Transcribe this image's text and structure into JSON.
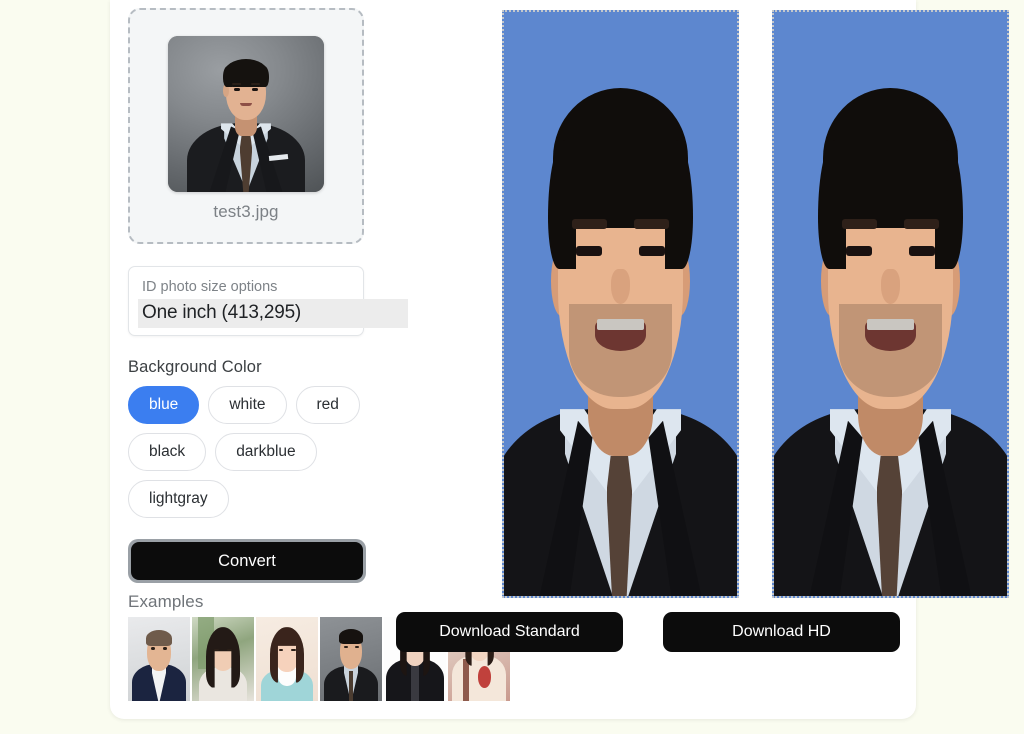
{
  "page": {
    "background_color": "#fafcf0",
    "card_background": "#ffffff"
  },
  "upload": {
    "filename": "test3.jpg",
    "thumbnail_alt": "uploaded-portrait-gray-studio-background"
  },
  "size_select": {
    "label": "ID photo size options",
    "selected_value": "One inch (413,295)",
    "options": [
      "One inch (413,295)"
    ]
  },
  "background_color_group": {
    "title": "Background Color",
    "selected": "blue",
    "selected_chip_color": "#3b7ef0",
    "options": [
      {
        "label": "blue",
        "selected": true
      },
      {
        "label": "white",
        "selected": false
      },
      {
        "label": "red",
        "selected": false
      },
      {
        "label": "black",
        "selected": false
      },
      {
        "label": "darkblue",
        "selected": false
      },
      {
        "label": "lightgray",
        "selected": false
      }
    ]
  },
  "convert": {
    "label": "Convert",
    "focused": true
  },
  "examples": {
    "title": "Examples",
    "items": [
      {
        "alt": "example-man-dark-suit-white-shirt"
      },
      {
        "alt": "example-woman-long-dark-hair-outdoor"
      },
      {
        "alt": "example-woman-light-blue-top"
      },
      {
        "alt": "example-man-suit-tie-gray-background"
      },
      {
        "alt": "example-person-black-jacket"
      },
      {
        "alt": "example-person-floral-shirt"
      }
    ]
  },
  "previews": [
    {
      "name": "standard",
      "background_color": "#5d87cf",
      "alt": "converted-id-photo-blue-background-standard"
    },
    {
      "name": "hd",
      "background_color": "#5d87cf",
      "alt": "converted-id-photo-blue-background-hd"
    }
  ],
  "downloads": {
    "standard_label": "Download Standard",
    "hd_label": "Download HD"
  }
}
